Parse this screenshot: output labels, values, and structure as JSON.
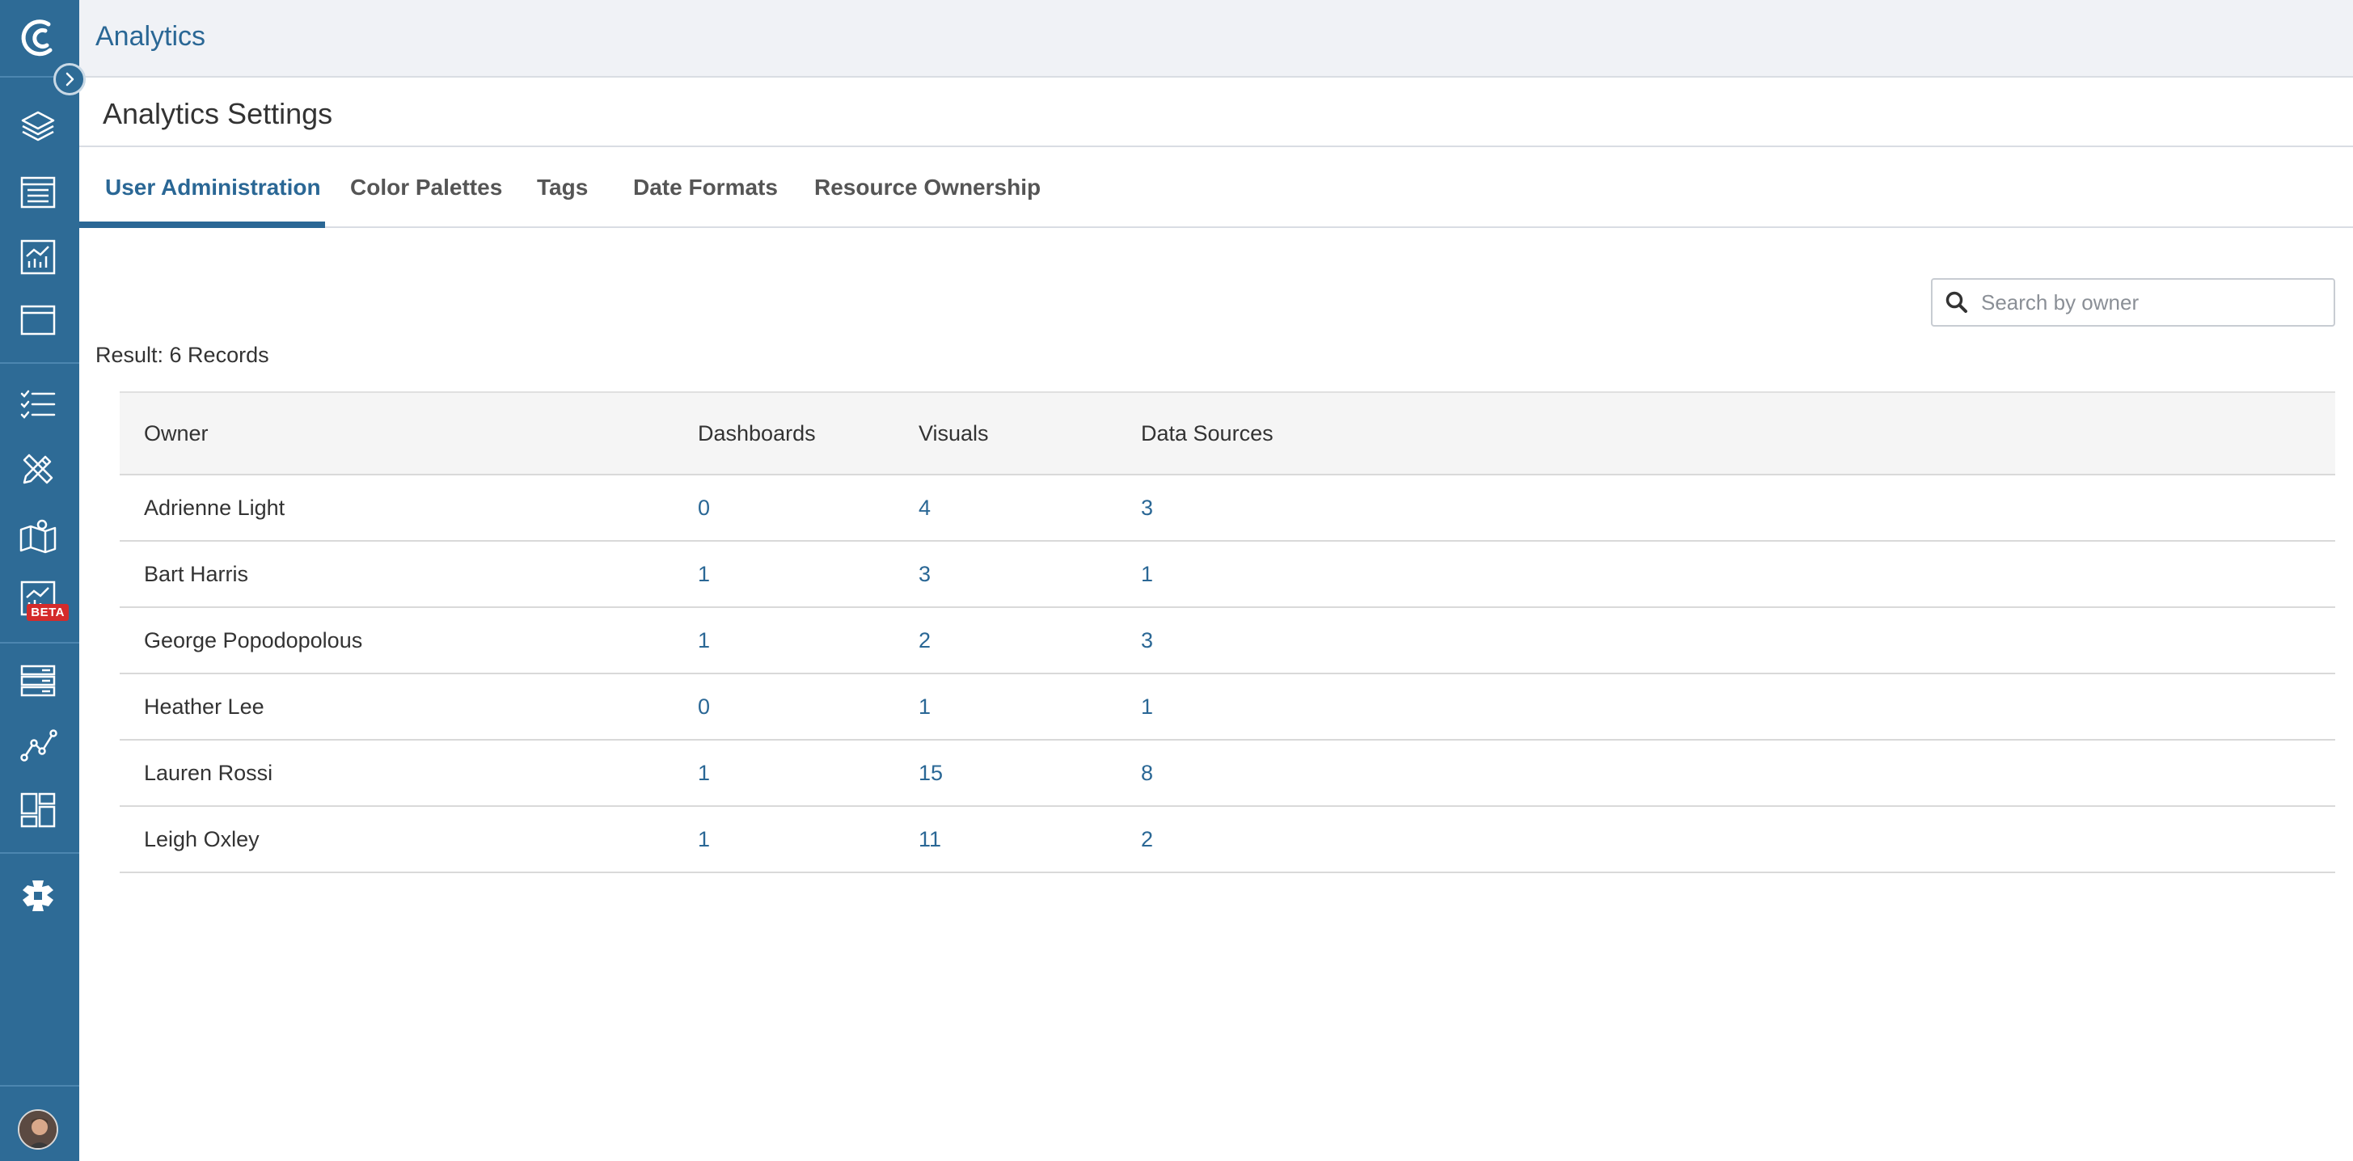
{
  "app": {
    "title": "Analytics"
  },
  "sidebar": {
    "icons": [
      "logo-icon",
      "layers-icon",
      "table-icon",
      "chart-icon",
      "window-icon",
      "checklist-icon",
      "design-tools-icon",
      "map-icon",
      "beta-chart-icon",
      "storage-icon",
      "path-icon",
      "dashboard-grid-icon",
      "puzzle-icon"
    ],
    "beta_label": "BETA"
  },
  "page": {
    "title": "Analytics Settings"
  },
  "tabs": [
    {
      "label": "User Administration",
      "active": true
    },
    {
      "label": "Color Palettes",
      "active": false
    },
    {
      "label": "Tags",
      "active": false
    },
    {
      "label": "Date Formats",
      "active": false
    },
    {
      "label": "Resource Ownership",
      "active": false
    }
  ],
  "search": {
    "placeholder": "Search by owner",
    "value": ""
  },
  "result": {
    "text": "Result: 6 Records"
  },
  "table": {
    "columns": [
      "Owner",
      "Dashboards",
      "Visuals",
      "Data Sources"
    ],
    "rows": [
      [
        "Adrienne Light",
        "0",
        "4",
        "3"
      ],
      [
        "Bart Harris",
        "1",
        "3",
        "1"
      ],
      [
        "George Popodopolous",
        "1",
        "2",
        "3"
      ],
      [
        "Heather Lee",
        "0",
        "1",
        "1"
      ],
      [
        "Lauren Rossi",
        "1",
        "15",
        "8"
      ],
      [
        "Leigh Oxley",
        "1",
        "11",
        "2"
      ]
    ]
  },
  "colors": {
    "sidebar": "#2e6b96",
    "accent": "#2a6795",
    "topbar": "#f0f2f6",
    "beta": "#d42b2b"
  }
}
